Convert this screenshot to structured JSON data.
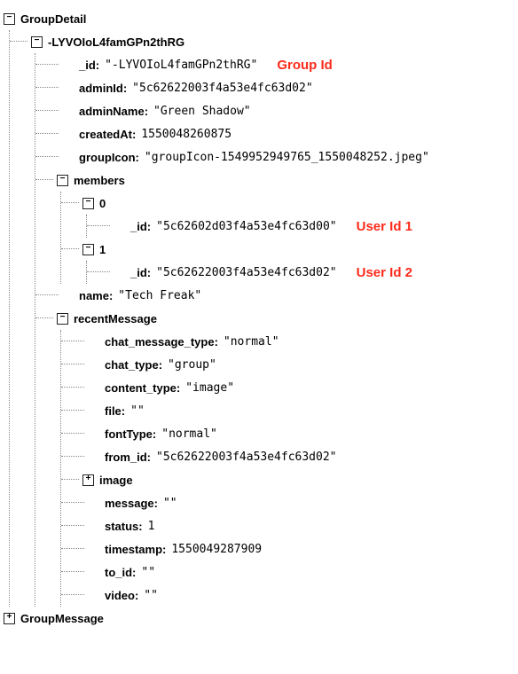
{
  "tree": {
    "groupDetail": {
      "label": "GroupDetail",
      "child": {
        "label": "-LYVOIoL4famGPn2thRG",
        "fields": {
          "id_key": "_id:",
          "id_val": "\"-LYVOIoL4famGPn2thRG\"",
          "adminId_key": "adminId:",
          "adminId_val": "\"5c62622003f4a53e4fc63d02\"",
          "adminName_key": "adminName:",
          "adminName_val": "\"Green Shadow\"",
          "createdAt_key": "createdAt:",
          "createdAt_val": "1550048260875",
          "groupIcon_key": "groupIcon:",
          "groupIcon_val": "\"groupIcon-1549952949765_1550048252.jpeg\"",
          "members_label": "members",
          "members": {
            "m0": {
              "label": "0",
              "id_key": "_id:",
              "id_val": "\"5c62602d03f4a53e4fc63d00\""
            },
            "m1": {
              "label": "1",
              "id_key": "_id:",
              "id_val": "\"5c62622003f4a53e4fc63d02\""
            }
          },
          "name_key": "name:",
          "name_val": "\"Tech Freak\"",
          "recentMessage_label": "recentMessage",
          "recentMessage": {
            "chat_message_type_key": "chat_message_type:",
            "chat_message_type_val": "\"normal\"",
            "chat_type_key": "chat_type:",
            "chat_type_val": "\"group\"",
            "content_type_key": "content_type:",
            "content_type_val": "\"image\"",
            "file_key": "file:",
            "file_val": "\"\"",
            "fontType_key": "fontType:",
            "fontType_val": "\"normal\"",
            "from_id_key": "from_id:",
            "from_id_val": "\"5c62622003f4a53e4fc63d02\"",
            "image_label": "image",
            "message_key": "message:",
            "message_val": "\"\"",
            "status_key": "status:",
            "status_val": "1",
            "timestamp_key": "timestamp:",
            "timestamp_val": "1550049287909",
            "to_id_key": "to_id:",
            "to_id_val": "\"\"",
            "video_key": "video:",
            "video_val": "\"\""
          }
        }
      }
    },
    "groupMessage": {
      "label": "GroupMessage"
    }
  },
  "annotations": {
    "group_id": "Group Id",
    "user_id_1": "User Id 1",
    "user_id_2": "User Id 2"
  },
  "glyphs": {
    "minus": "−",
    "plus": "+"
  }
}
